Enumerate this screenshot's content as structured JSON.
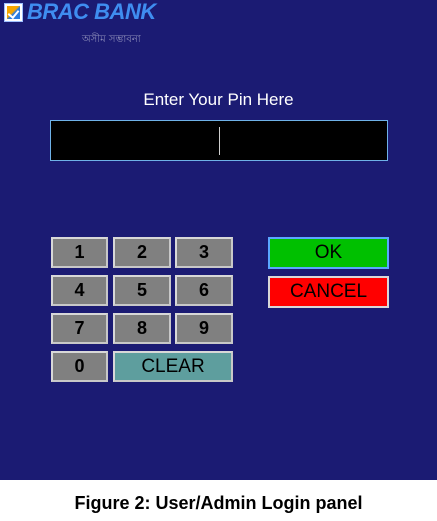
{
  "brand": {
    "name": "BRAC BANK",
    "tagline": "অসীম সম্ভাবনা"
  },
  "pin_prompt": "Enter Your Pin Here",
  "pin_field": {
    "value": ""
  },
  "keypad": {
    "keys": [
      "1",
      "2",
      "3",
      "4",
      "5",
      "6",
      "7",
      "8",
      "9",
      "0"
    ],
    "clear_label": "CLEAR"
  },
  "actions": {
    "ok_label": "OK",
    "cancel_label": "CANCEL"
  },
  "caption": "Figure 2: User/Admin Login panel",
  "colors": {
    "panel_bg": "#1b1b73",
    "ok": "#00c000",
    "cancel": "#ff0000",
    "key": "#808080",
    "clear_key": "#5e9e9e"
  }
}
